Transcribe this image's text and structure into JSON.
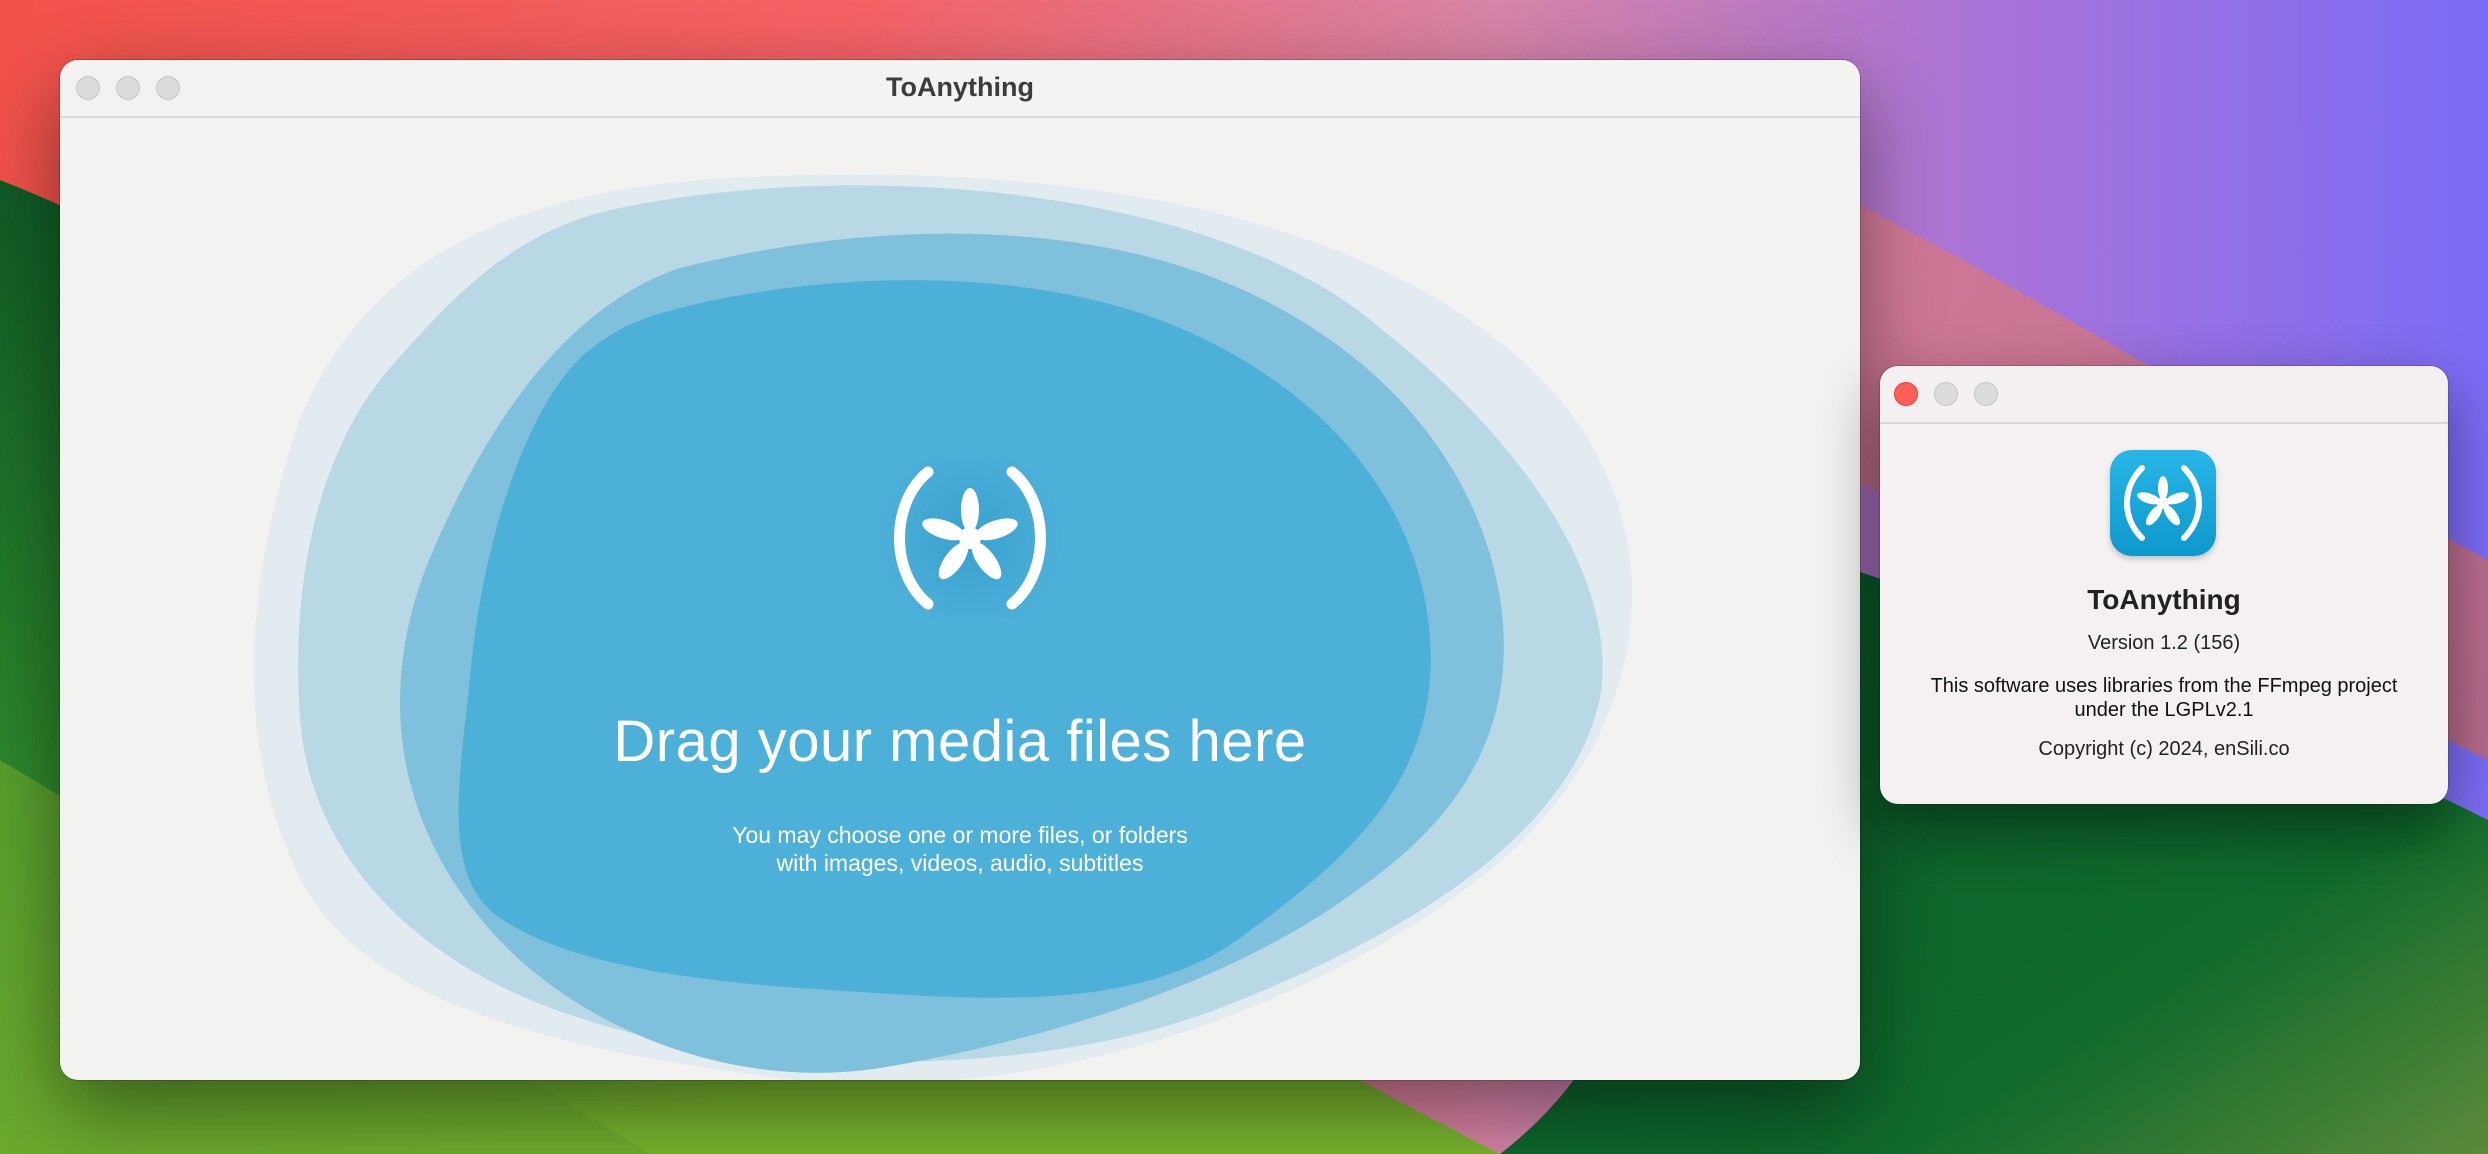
{
  "main_window": {
    "title": "ToAnything",
    "drop_zone": {
      "title": "Drag your media files here",
      "subtitle_line1": "You may choose one or more files, or folders",
      "subtitle_line2": "with images, videos, audio, subtitles",
      "logo_icon": "asterisk-in-parentheses-icon"
    },
    "traffic_lights": [
      "close-button",
      "minimize-button",
      "zoom-button"
    ]
  },
  "about_window": {
    "app_name": "ToAnything",
    "version": "Version 1.2 (156)",
    "license_line1": "This software uses libraries from the FFmpeg project",
    "license_line2": "under the LGPLv2.1",
    "copyright": "Copyright (c) 2024, enSili.co",
    "app_icon": "asterisk-in-parentheses-icon",
    "close_color": "#ff5f57"
  },
  "colors": {
    "accent_blue": "#4db0d9",
    "light_blue": "#b9d9e6"
  }
}
